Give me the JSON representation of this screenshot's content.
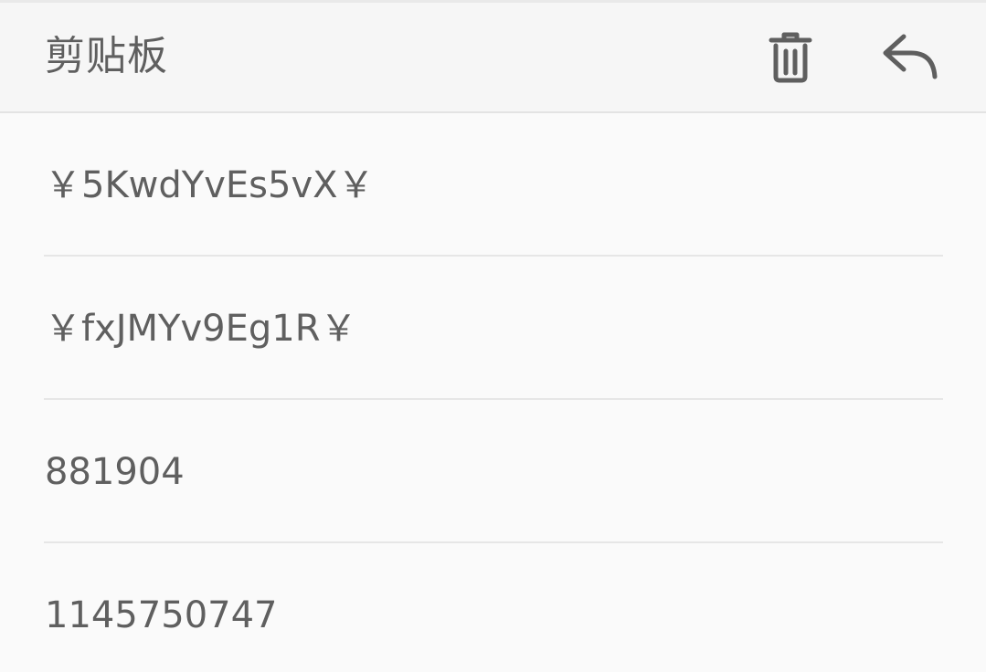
{
  "header": {
    "title": "剪贴板",
    "icons": {
      "delete": "trash-icon",
      "back": "reply-arrow-icon"
    }
  },
  "clipboard_items": [
    {
      "text": "￥5KwdYvEs5vX￥"
    },
    {
      "text": "￥fxJMYv9Eg1R￥"
    },
    {
      "text": "881904"
    },
    {
      "text": "1145750747"
    }
  ],
  "colors": {
    "background": "#fafafa",
    "header_background": "#f6f6f6",
    "text": "#5f5f5f",
    "divider": "#e6e6e6"
  }
}
